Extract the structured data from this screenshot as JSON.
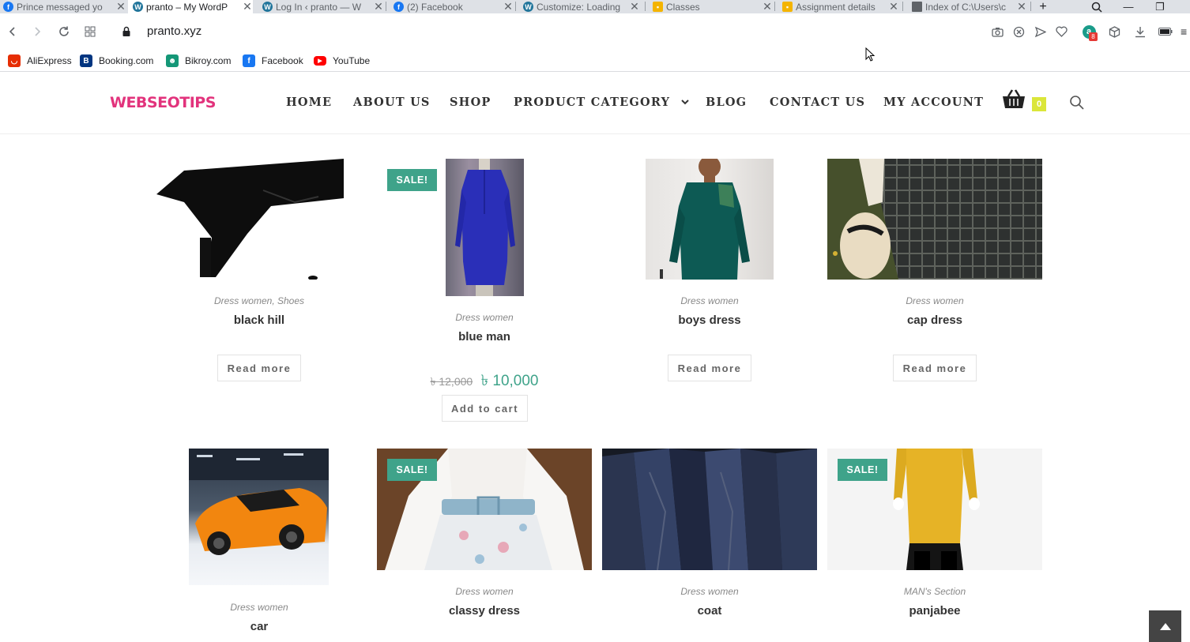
{
  "browser": {
    "tabs": [
      {
        "title": "Prince messaged yo",
        "favicon": "facebook-icon"
      },
      {
        "title": "pranto – My WordP",
        "favicon": "wordpress-icon",
        "active": true
      },
      {
        "title": "Log In ‹ pranto — W",
        "favicon": "wordpress-icon"
      },
      {
        "title": "(2) Facebook",
        "favicon": "facebook-icon"
      },
      {
        "title": "Customize: Loading",
        "favicon": "wordpress-icon"
      },
      {
        "title": "Classes",
        "favicon": "classroom-icon"
      },
      {
        "title": "Assignment details",
        "favicon": "classroom-icon"
      },
      {
        "title": "Index of C:\\Users\\c",
        "favicon": "file-icon"
      }
    ],
    "url": "pranto.xyz",
    "extension_badge": "8",
    "bookmarks": [
      {
        "label": "AliExpress",
        "icon": "aliexpress-icon",
        "color": "#e62e04"
      },
      {
        "label": "Booking.com",
        "icon": "booking-icon",
        "color": "#003580"
      },
      {
        "label": "Bikroy.com",
        "icon": "bikroy-icon",
        "color": "#149777"
      },
      {
        "label": "Facebook",
        "icon": "facebook-icon",
        "color": "#1877f2"
      },
      {
        "label": "YouTube",
        "icon": "youtube-icon",
        "color": "#ff0000"
      }
    ]
  },
  "site": {
    "logo": "WEBSEOTIPS",
    "menu": [
      "HOME",
      "ABOUT US",
      "SHOP",
      "PRODUCT CATEGORY",
      "BLOG",
      "CONTACT US",
      "MY ACCOUNT"
    ],
    "cart_count": "0",
    "colors": {
      "brand": "#e2337c",
      "sale": "#3fa38a",
      "cart_badge": "#dbe63a"
    }
  },
  "products": [
    {
      "category": "Dress women, Shoes",
      "title": "black hill",
      "button": "Read more",
      "sale": false
    },
    {
      "category": "Dress women",
      "title": "blue man",
      "button": "Add to cart",
      "sale": true,
      "sale_label": "SALE!",
      "old_price": "৳ 12,000",
      "new_price": "৳ 10,000"
    },
    {
      "category": "Dress women",
      "title": "boys dress",
      "button": "Read more",
      "sale": false
    },
    {
      "category": "Dress women",
      "title": "cap dress",
      "button": "Read more",
      "sale": false
    },
    {
      "category": "Dress women",
      "title": "car",
      "sale": false
    },
    {
      "category": "Dress women",
      "title": "classy dress",
      "sale": true,
      "sale_label": "SALE!"
    },
    {
      "category": "Dress women",
      "title": "coat",
      "sale": false
    },
    {
      "category": "MAN's Section",
      "title": "panjabee",
      "sale": true,
      "sale_label": "SALE!"
    }
  ]
}
